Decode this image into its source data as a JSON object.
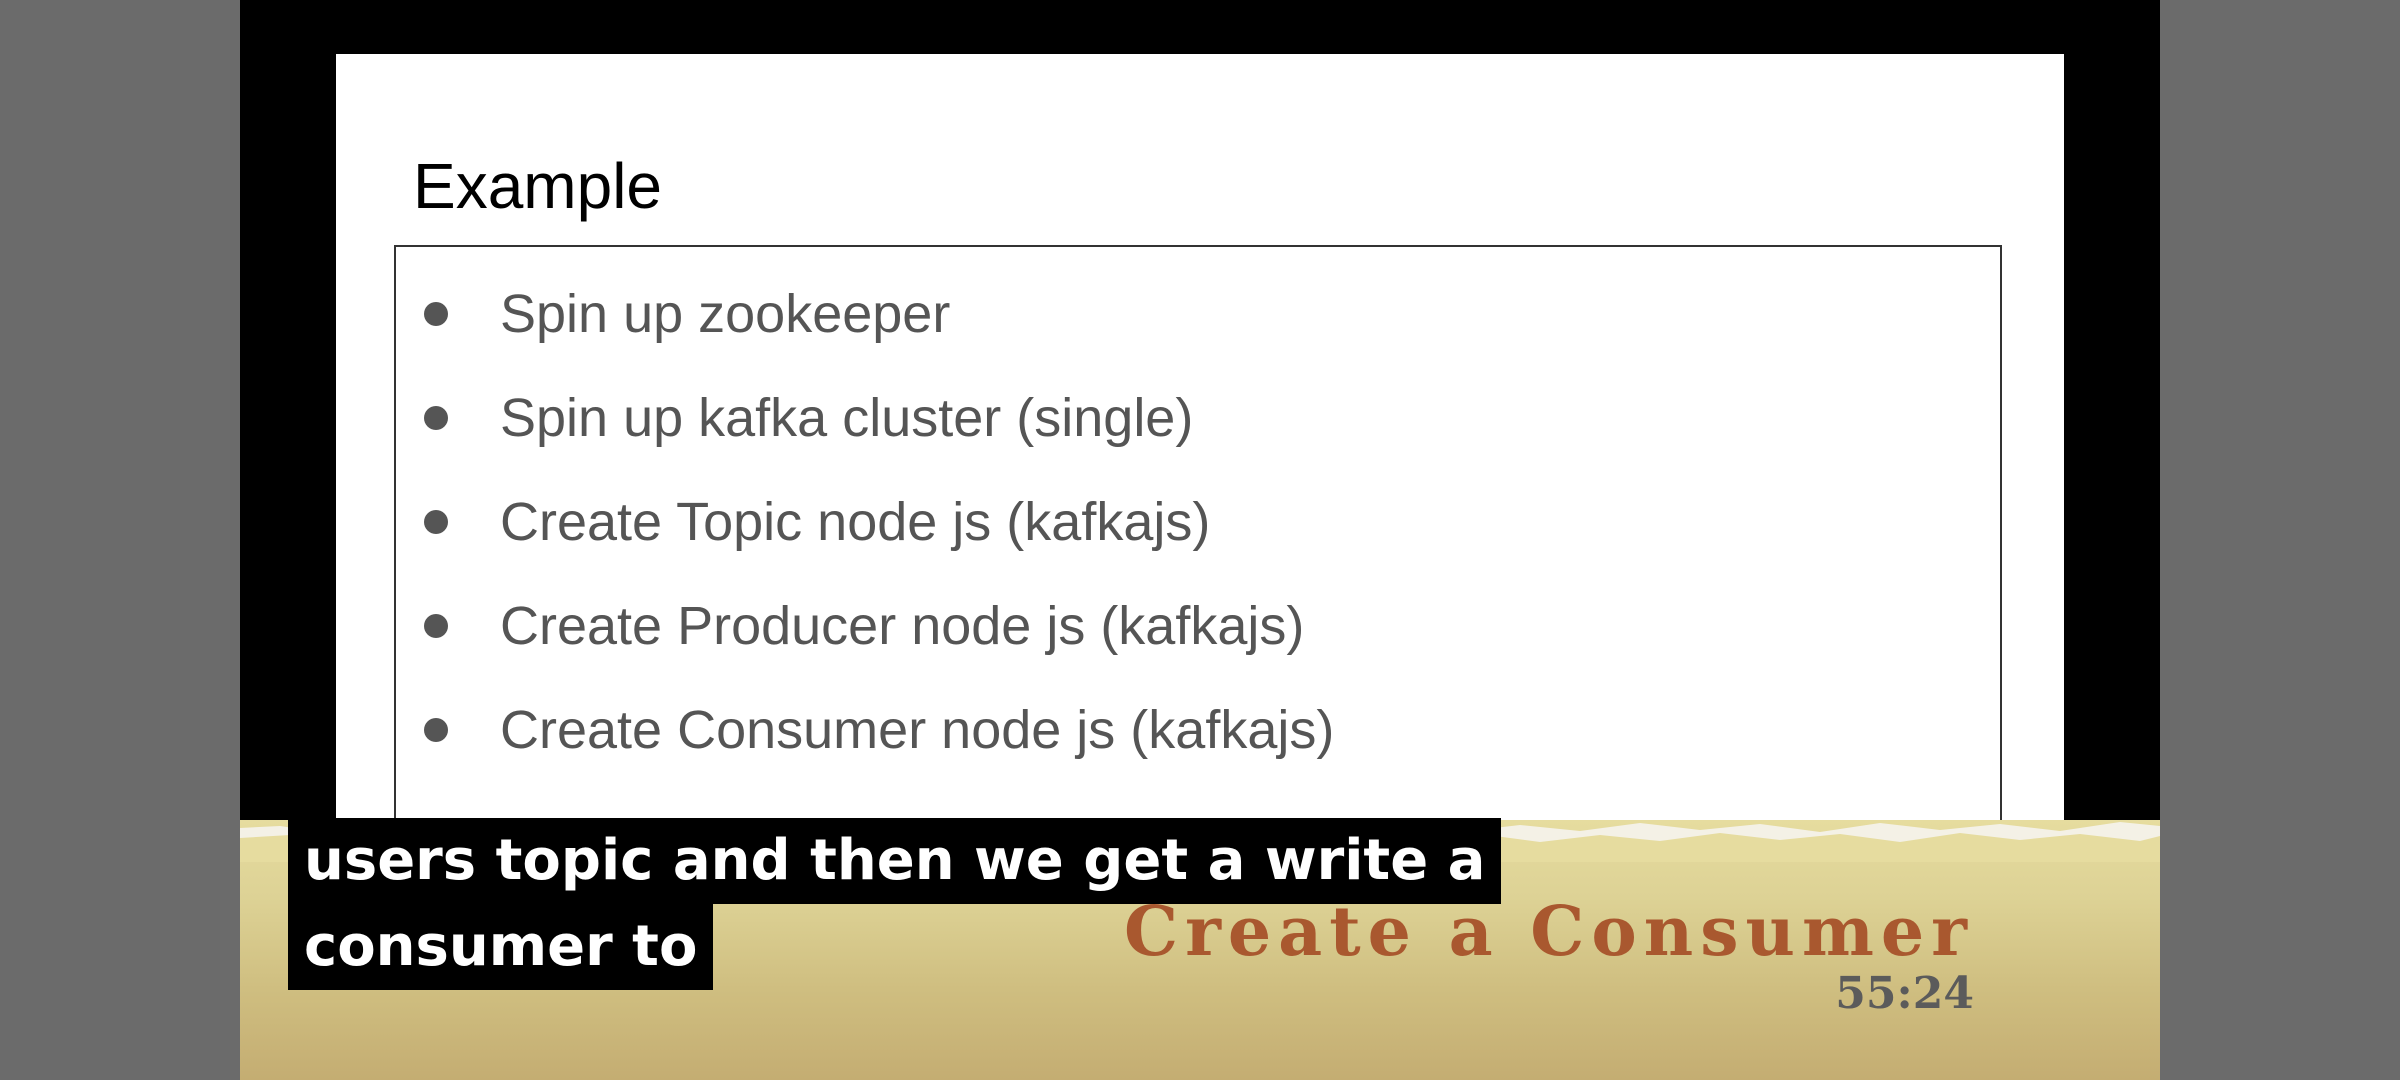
{
  "slide": {
    "title": "Example",
    "bullets": [
      "Spin up zookeeper",
      "Spin up kafka cluster (single)",
      "Create Topic node js (kafkajs)",
      "Create Producer node js (kafkajs)",
      "Create Consumer node js (kafkajs)"
    ]
  },
  "caption": {
    "lines": [
      "users topic and then we get a write a",
      "consumer to"
    ]
  },
  "banner": {
    "course_title": "Create a Consumer",
    "timestamp": "55:24"
  },
  "colors": {
    "background": "#6b6b6b",
    "video_frame": "#000000",
    "slide": "#ffffff",
    "bullet_text": "#555555",
    "banner_title": "#a9582f",
    "banner_timestamp": "#5b5b5b",
    "banner_paper": "#ddd295"
  }
}
